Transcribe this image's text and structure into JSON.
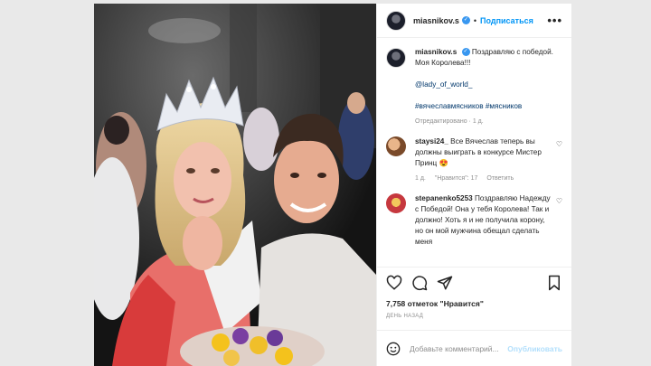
{
  "post": {
    "username": "miasnikov.s",
    "follow_label": "Подписаться",
    "more_label": "•••"
  },
  "caption": {
    "username": "miasnikov.s",
    "text": "Поздравляю с победой. Моя Королева!!!",
    "mention": "@lady_of_world_",
    "hashtags": "#вячеславмясников #мясников",
    "meta": "Отредактировано · 1 д."
  },
  "comments": [
    {
      "username": "staysi24_",
      "text": "Все Вячеслав теперь вы должны выиграть в конкурсе Мистер Принц",
      "emoji": "😍",
      "time": "1 д.",
      "likes": "\"Нравится\": 17",
      "reply": "Ответить"
    },
    {
      "username": "stepanenko5253",
      "text": "Поздравляю Надежду с Победой! Она у тебя Королева! Так и должно! Хоть я и не получила корону, но он мой мужчина обещал сделать меня"
    }
  ],
  "actions": {
    "likes_count": "7,758 отметок \"Нравится\"",
    "time_ago": "ДЕНЬ НАЗАД"
  },
  "add_comment": {
    "placeholder": "Добавьте комментарий...",
    "post_label": "Опубликовать"
  },
  "colors": {
    "accent": "#0095f6",
    "verified": "#3897f0",
    "hashtag": "#00376b"
  }
}
